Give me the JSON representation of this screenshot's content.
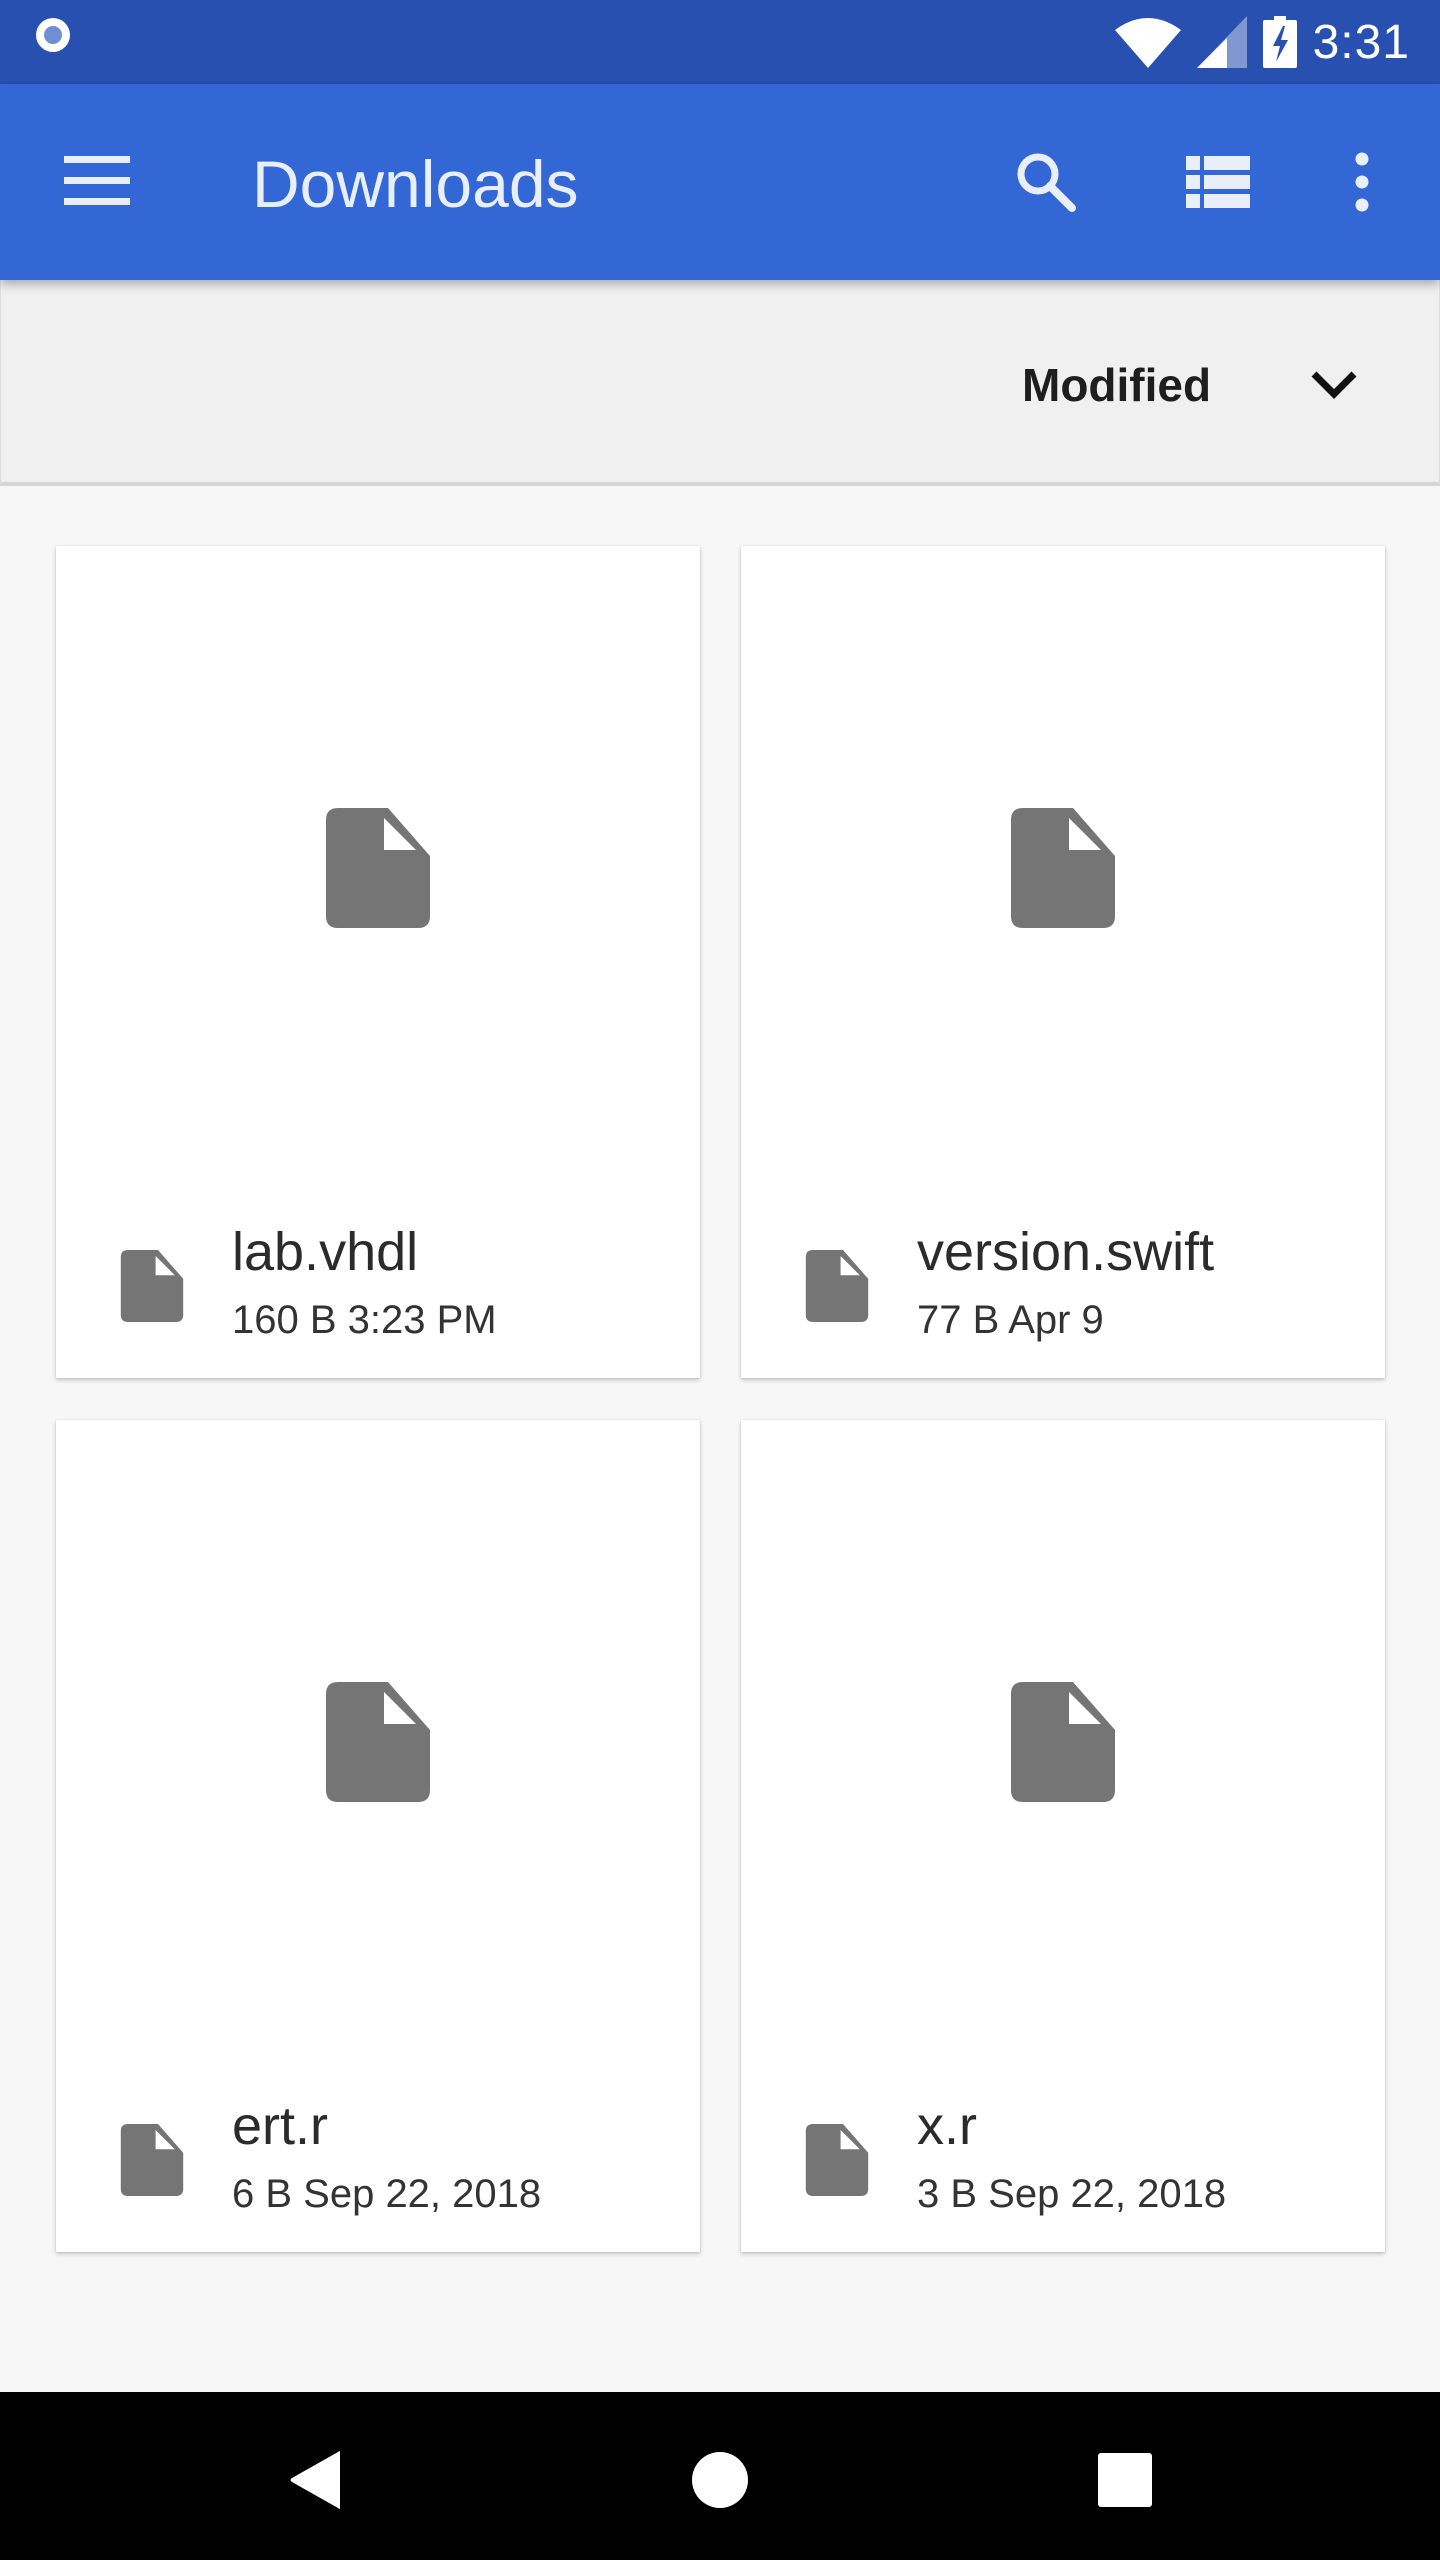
{
  "status_bar": {
    "time": "3:31",
    "icons": [
      "notification-dot-icon",
      "wifi-icon",
      "cell-signal-icon",
      "battery-charging-icon"
    ]
  },
  "app_bar": {
    "title": "Downloads",
    "actions": [
      "menu-icon",
      "search-icon",
      "list-view-icon",
      "more-vert-icon"
    ]
  },
  "sort": {
    "label": "Modified",
    "icon": "chevron-down-icon"
  },
  "files": [
    {
      "name": "lab.vhdl",
      "meta": "160 B 3:23 PM"
    },
    {
      "name": "version.swift",
      "meta": "77 B Apr 9"
    },
    {
      "name": "ert.r",
      "meta": "6 B Sep 22, 2018"
    },
    {
      "name": "x.r",
      "meta": "3 B Sep 22, 2018"
    }
  ],
  "nav_bar": {
    "buttons": [
      "back-icon",
      "home-icon",
      "recents-icon"
    ]
  },
  "colors": {
    "status_bar": "#2750b1",
    "app_bar": "#3367d6",
    "file_icon": "#757575",
    "background": "#f7f7f7"
  }
}
